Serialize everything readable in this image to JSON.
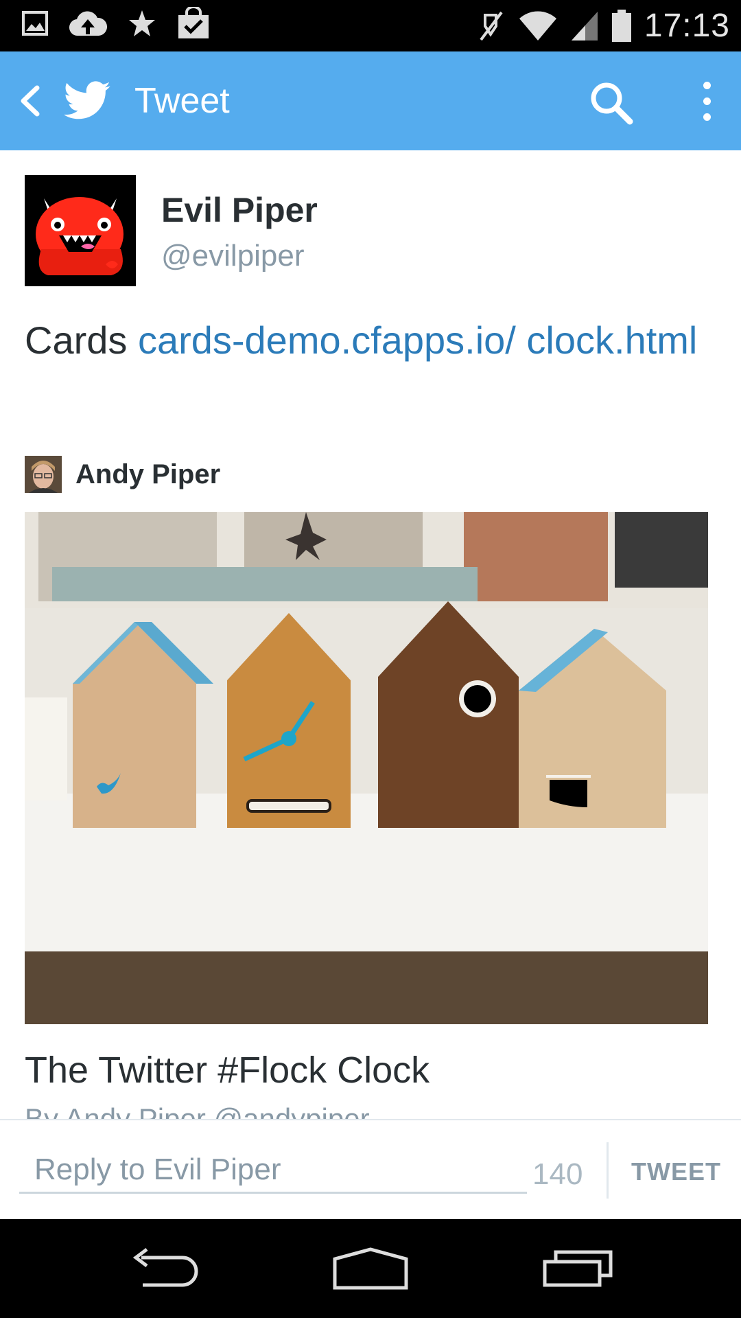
{
  "status_bar": {
    "time": "17:13",
    "left_icons": [
      "image-icon",
      "cloud-upload-icon",
      "star-icon",
      "shopping-bag-check-icon"
    ],
    "right_icons": [
      "mute-icon",
      "wifi-icon",
      "signal-icon",
      "battery-icon"
    ]
  },
  "app_bar": {
    "title": "Tweet",
    "background": "#55acee"
  },
  "tweet": {
    "author_name": "Evil Piper",
    "author_handle": "@evilpiper",
    "text_prefix": "Cards ",
    "link_text": "cards-demo.cfapps.io/ clock.html",
    "link_color": "#2b7bb9"
  },
  "card": {
    "author_name": "Andy Piper",
    "title": "The Twitter #Flock Clock",
    "byline": "By Andy Piper @andypiper"
  },
  "reply": {
    "placeholder": "Reply to Evil Piper",
    "char_count": "140",
    "button_label": "TWEET"
  },
  "nav_bar": {
    "icons": [
      "back-nav-icon",
      "home-nav-icon",
      "recents-nav-icon"
    ]
  }
}
